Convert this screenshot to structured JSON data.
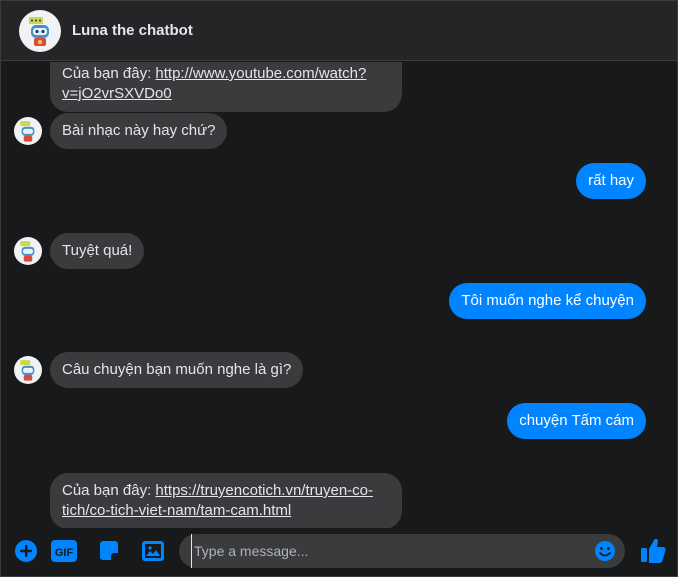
{
  "header": {
    "title": "Luna the chatbot"
  },
  "messages": [
    {
      "from": "bot",
      "text_prefix": "Của bạn đây: ",
      "link_line1": "http://www.youtube.com/watch?",
      "link_line2": "v=jO2vrSXVDo0"
    },
    {
      "from": "bot",
      "text": "Bài nhạc này hay chứ?"
    },
    {
      "from": "user",
      "text": "rất hay"
    },
    {
      "from": "bot",
      "text": "Tuyệt quá!"
    },
    {
      "from": "user",
      "text": "Tôi muốn nghe kể chuyện"
    },
    {
      "from": "bot",
      "text": "Câu chuyện bạn muốn nghe là gì?"
    },
    {
      "from": "user",
      "text": "chuyện Tấm cám"
    },
    {
      "from": "bot",
      "text_prefix": "Của bạn đây: ",
      "link_line1": "https://truyencotich.vn/truyen-co-",
      "link_line2": "tich/co-tich-viet-nam/tam-cam.html"
    }
  ],
  "composer": {
    "placeholder": "Type a message...",
    "value": ""
  },
  "icons": {
    "add": "plus-circle-icon",
    "gif": "gif-icon",
    "sticker": "sticker-icon",
    "image": "image-icon",
    "emoji": "emoji-icon",
    "like": "thumbs-up-icon"
  },
  "colors": {
    "accent": "#0084ff",
    "background": "#18191a",
    "bot_bubble": "#3a3b3c",
    "header": "#242526"
  }
}
